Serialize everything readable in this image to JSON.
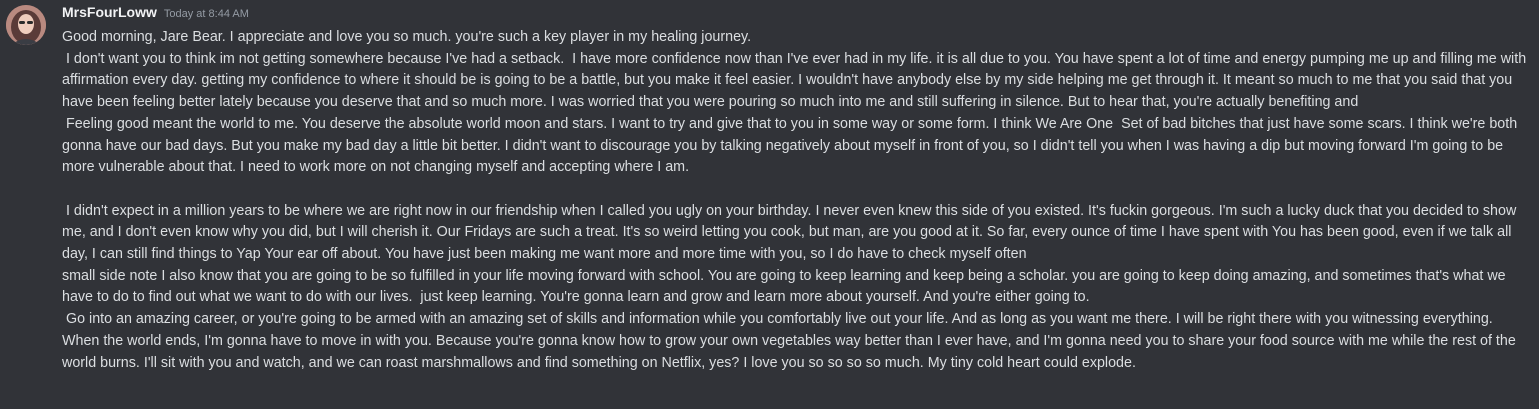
{
  "message": {
    "username": "MrsFourLoww",
    "timestamp": "Today at 8:44 AM",
    "paragraphs": [
      "Good morning, Jare Bear. I appreciate and love you so much. you're such a key player in my healing journey.\n I don't want you to think im not getting somewhere because I've had a setback.  I have more confidence now than I've ever had in my life. it is all due to you. You have spent a lot of time and energy pumping me up and filling me with affirmation every day. getting my confidence to where it should be is going to be a battle, but you make it feel easier. I wouldn't have anybody else by my side helping me get through it. It meant so much to me that you said that you have been feeling better lately because you deserve that and so much more. I was worried that you were pouring so much into me and still suffering in silence. But to hear that, you're actually benefiting and\n Feeling good meant the world to me. You deserve the absolute world moon and stars. I want to try and give that to you in some way or some form. I think We Are One  Set of bad bitches that just have some scars. I think we're both gonna have our bad days. But you make my bad day a little bit better. I didn't want to discourage you by talking negatively about myself in front of you, so I didn't tell you when I was having a dip but moving forward I'm going to be more vulnerable about that. I need to work more on not changing myself and accepting where I am.\n\n I didn't expect in a million years to be where we are right now in our friendship when I called you ugly on your birthday. I never even knew this side of you existed. It's fuckin gorgeous. I'm such a lucky duck that you decided to show me, and I don't even know why you did, but I will cherish it. Our Fridays are such a treat. It's so weird letting you cook, but man, are you good at it. So far, every ounce of time I have spent with You has been good, even if we talk all day, I can still find things to Yap Your ear off about. You have just been making me want more and more time with you, so I do have to check myself often",
      "small side note I also know that you are going to be so fulfilled in your life moving forward with school. You are going to keep learning and keep being a scholar. you are going to keep doing amazing, and sometimes that's what we have to do to find out what we want to do with our lives.  just keep learning. You're gonna learn and grow and learn more about yourself. And you're either going to.\n Go into an amazing career, or you're going to be armed with an amazing set of skills and information while you comfortably live out your life. And as long as you want me there. I will be right there with you witnessing everything. When the world ends, I'm gonna have to move in with you. Because you're gonna know how to grow your own vegetables way better than I ever have, and I'm gonna need you to share your food source with me while the rest of the world burns. I'll sit with you and watch, and we can roast marshmallows and find something on Netflix, yes? I love you so so so so much. My tiny cold heart could explode."
    ]
  }
}
